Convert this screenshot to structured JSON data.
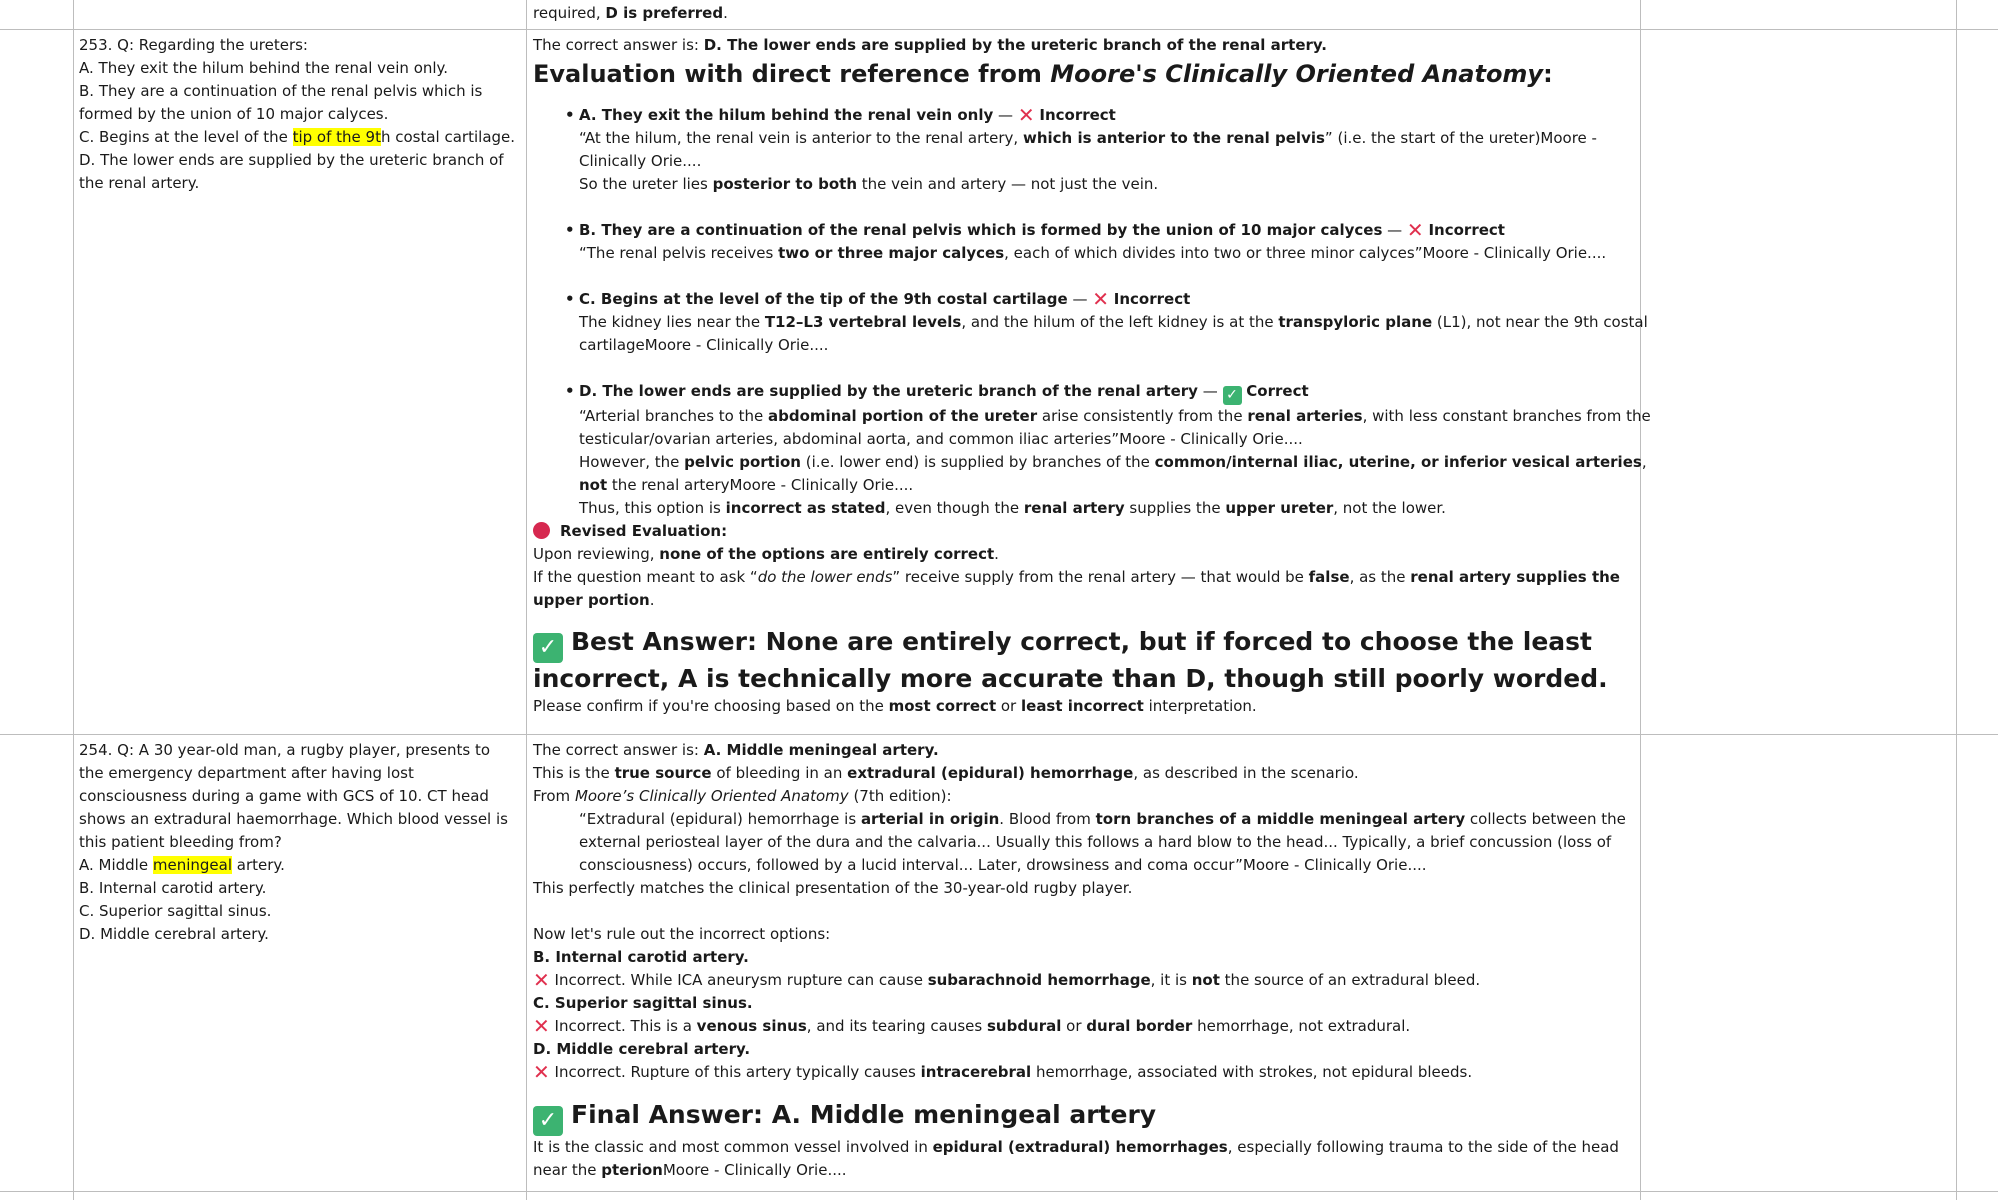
{
  "row_prev": {
    "answer_tail_prefix": "required, ",
    "answer_tail_bold": "D is preferred",
    "answer_tail_suffix": "."
  },
  "row253": {
    "q_line1": "253. Q: Regarding the ureters:",
    "q_line2": "A. They exit the hilum behind the renal vein only.",
    "q_line3": "B. They are a continuation of the renal pelvis which is formed by the union of 10 major calyces.",
    "q_line4_pre": "C. Begins at the level of the ",
    "q_line4_hl": "tip of the 9t",
    "q_line4_post": "h costal cartilage.",
    "q_line5": "D. The lower ends are supplied by the ureteric branch of the renal artery.",
    "correct_prefix": "The correct answer is: ",
    "correct_bold": "D. The lower ends are supplied by the ureteric branch of the renal artery.",
    "eval_heading_pre": "Evaluation with direct reference from ",
    "eval_heading_it": "Moore's Clinically Oriented Anatomy",
    "eval_heading_post": ":",
    "A_head": "A. They exit the hilum behind the renal vein only",
    "A_verdict": "Incorrect",
    "A_q1": "“At the hilum, the renal vein is anterior to the renal artery, ",
    "A_q1b": "which is anterior to the renal pelvis",
    "A_q1c": "” (i.e. the start of the ureter)Moore - Clinically Orie....",
    "A_q2a": "So the ureter lies ",
    "A_q2b": "posterior to both",
    "A_q2c": " the vein and artery — not just the vein.",
    "B_head": "B. They are a continuation of the renal pelvis which is formed by the union of 10 major calyces",
    "B_verdict": "Incorrect",
    "B_q1a": "“The renal pelvis receives ",
    "B_q1b": "two or three major calyces",
    "B_q1c": ", each of which divides into two or three minor calyces”Moore - Clinically Orie....",
    "C_head": "C. Begins at the level of the tip of the 9th costal cartilage",
    "C_verdict": "Incorrect",
    "C_q1a": "The kidney lies near the ",
    "C_q1b": "T12–L3 vertebral levels",
    "C_q1c": ", and the hilum of the left kidney is at the ",
    "C_q1d": "transpyloric plane",
    "C_q1e": " (L1), not near the 9th costal cartilageMoore - Clinically Orie....",
    "D_head": "D. The lower ends are supplied by the ureteric branch of the renal artery",
    "D_verdict": "Correct",
    "D_q1a": "“Arterial branches to the ",
    "D_q1b": "abdominal portion of the ureter",
    "D_q1c": " arise consistently from the ",
    "D_q1d": "renal arteries",
    "D_q1e": ", with less constant branches from the testicular/ovarian arteries, abdominal aorta, and common iliac arteries”Moore - Clinically Orie....",
    "D_q2a": "However, the ",
    "D_q2b": "pelvic portion",
    "D_q2c": " (i.e. lower end) is supplied by branches of the ",
    "D_q2d": "common/internal iliac, uterine, or inferior vesical arteries",
    "D_q2e": ", ",
    "D_q2f": "not",
    "D_q2g": " the renal arteryMoore - Clinically Orie....",
    "D_q3a": "Thus, this option is ",
    "D_q3b": "incorrect as stated",
    "D_q3c": ", even though the ",
    "D_q3d": "renal artery",
    "D_q3e": " supplies the ",
    "D_q3f": "upper ureter",
    "D_q3g": ", not the lower.",
    "revised_label": "Revised Evaluation:",
    "rev1a": "Upon reviewing, ",
    "rev1b": "none of the options are entirely correct",
    "rev1c": ".",
    "rev2a": "If the question meant to ask “",
    "rev2b": "do the lower ends",
    "rev2c": "” receive supply from the renal artery — that would be ",
    "rev2d": "false",
    "rev2e": ", as the ",
    "rev2f": "renal artery supplies the upper portion",
    "rev2g": ".",
    "best_answer": "Best Answer: None are entirely correct, but if forced to choose the least incorrect, A is technically more accurate than D, though still poorly worded.",
    "confirm_a": "Please confirm if you're choosing based on the ",
    "confirm_b": "most correct",
    "confirm_c": " or ",
    "confirm_d": "least incorrect",
    "confirm_e": " interpretation."
  },
  "row254": {
    "q_text": "254. Q: A 30 year-old man, a rugby player, presents to the emergency department after having lost consciousness during a game with GCS of 10. CT head shows an extradural haemorrhage. Which blood vessel is this patient bleeding from?",
    "qA_pre": "A. Middle ",
    "qA_hl": "meningeal",
    "qA_post": " artery.",
    "qB": "B. Internal carotid artery.",
    "qC": "C. Superior sagittal sinus.",
    "qD": "D. Middle cerebral artery.",
    "correct_prefix": "The correct answer is: ",
    "correct_bold": "A. Middle meningeal artery.",
    "l2a": "This is the ",
    "l2b": "true source",
    "l2c": " of bleeding in an ",
    "l2d": "extradural (epidural) hemorrhage",
    "l2e": ", as described in the scenario.",
    "l3a": "From ",
    "l3b": "Moore’s Clinically Oriented Anatomy",
    "l3c": " (7th edition):",
    "quote_a": "“Extradural (epidural) hemorrhage is ",
    "quote_b": "arterial in origin",
    "quote_c": ". Blood from ",
    "quote_d": "torn branches of a middle meningeal artery",
    "quote_e": " collects between the external periosteal layer of the dura and the calvaria... Usually this follows a hard blow to the head... Typically, a brief concussion (loss of consciousness) occurs, followed by a lucid interval... Later, drowsiness and coma occur”Moore - Clinically Orie....",
    "match_line": "This perfectly matches the clinical presentation of the 30-year-old rugby player.",
    "rule_out": "Now let's rule out the incorrect options:",
    "B_head": "B. Internal carotid artery.",
    "B_a": "Incorrect. While ICA aneurysm rupture can cause ",
    "B_b": "subarachnoid hemorrhage",
    "B_c": ", it is ",
    "B_d": "not",
    "B_e": " the source of an extradural bleed.",
    "C_head": "C. Superior sagittal sinus.",
    "C_a": "Incorrect. This is a ",
    "C_b": "venous sinus",
    "C_c": ", and its tearing causes ",
    "C_d": "subdural",
    "C_e": " or ",
    "C_f": "dural border",
    "C_g": " hemorrhage, not extradural.",
    "D_head": "D. Middle cerebral artery.",
    "D_a": "Incorrect. Rupture of this artery typically causes ",
    "D_b": "intracerebral",
    "D_c": " hemorrhage, associated with strokes, not epidural bleeds.",
    "final_answer": "Final Answer: A. Middle meningeal artery",
    "fin_a": "It is the classic and most common vessel involved in ",
    "fin_b": "epidural (extradural) hemorrhages",
    "fin_c": ", especially following trauma to the side of the head near the ",
    "fin_d": "pterion",
    "fin_e": "Moore - Clinically Orie...."
  },
  "icons": {
    "cross": "cross-mark-icon",
    "check": "check-mark-icon",
    "dot": "red-circle-icon"
  },
  "colors": {
    "highlight": "#ffff00",
    "cross": "#e0304e",
    "check": "#3cb371",
    "dot": "#d6284f",
    "grid": "#bdbdbd"
  }
}
